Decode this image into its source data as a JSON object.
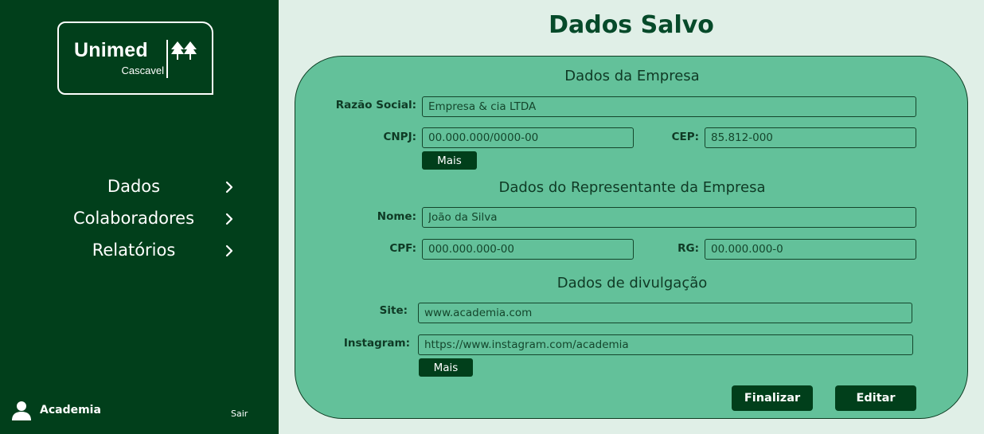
{
  "sidebar": {
    "logo": {
      "brand": "Unimed",
      "location": "Cascavel"
    },
    "nav": [
      {
        "label": "Dados",
        "icon": "chevron-right-icon"
      },
      {
        "label": "Colaboradores",
        "icon": "chevron-right-icon"
      },
      {
        "label": "Relatórios",
        "icon": "chevron-right-icon"
      }
    ],
    "user": {
      "icon": "user-icon",
      "name": "Academia",
      "logout_label": "Sair"
    }
  },
  "main": {
    "title": "Dados Salvo",
    "company": {
      "section_title": "Dados da Empresa",
      "razao_social": {
        "label": "Razão Social:",
        "value": "Empresa & cia LTDA"
      },
      "cnpj": {
        "label": "CNPJ:",
        "value": "00.000.000/0000-00"
      },
      "cep": {
        "label": "CEP:",
        "value": "85.812-000"
      },
      "more_label": "Mais"
    },
    "representative": {
      "section_title": "Dados do Representante da Empresa",
      "nome": {
        "label": "Nome:",
        "value": "João da Silva"
      },
      "cpf": {
        "label": "CPF:",
        "value": "000.000.000-00"
      },
      "rg": {
        "label": "RG:",
        "value": "00.000.000-0"
      }
    },
    "disclosure": {
      "section_title": "Dados de divulgação",
      "site": {
        "label": "Site:",
        "value": "www.academia.com"
      },
      "instagram": {
        "label": "Instagram:",
        "value": "https://www.instagram.com/academia"
      },
      "more_label": "Mais"
    },
    "actions": {
      "finish_label": "Finalizar",
      "edit_label": "Editar"
    }
  },
  "colors": {
    "sidebar_bg": "#013f1b",
    "page_bg": "#e0efe7",
    "card_bg": "#63c19a",
    "title_text": "#064a2a",
    "button_bg": "#013f1b"
  }
}
